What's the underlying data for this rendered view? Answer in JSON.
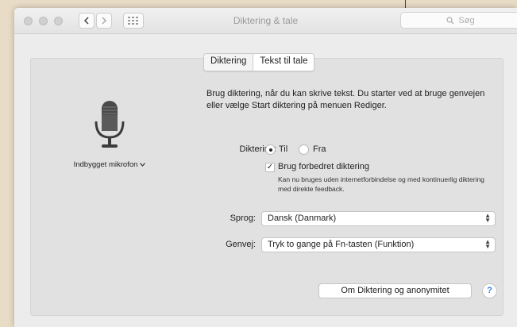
{
  "window": {
    "title": "Diktering & tale"
  },
  "search": {
    "placeholder": "Søg"
  },
  "tabs": [
    {
      "label": "Diktering",
      "selected": true
    },
    {
      "label": "Tekst til tale",
      "selected": false
    }
  ],
  "microphone": {
    "label": "Indbygget mikrofon",
    "icon": "microphone-icon"
  },
  "description": "Brug diktering, når du kan skrive tekst. Du starter ved at bruge genvejen eller vælge Start diktering på menuen Rediger.",
  "dictation": {
    "label": "Diktering:",
    "on_label": "Til",
    "off_label": "Fra",
    "selected": "Til",
    "enhanced_label": "Brug forbedret diktering",
    "enhanced_checked": true,
    "enhanced_note": "Kan nu bruges uden internetforbindelse og med kontinuerlig diktering med direkte feedback."
  },
  "language": {
    "label": "Sprog:",
    "value": "Dansk (Danmark)"
  },
  "shortcut": {
    "label": "Genvej:",
    "value": "Tryk to gange på Fn-tasten (Funktion)"
  },
  "about_button": "Om Diktering og anonymitet",
  "help_button": "?"
}
